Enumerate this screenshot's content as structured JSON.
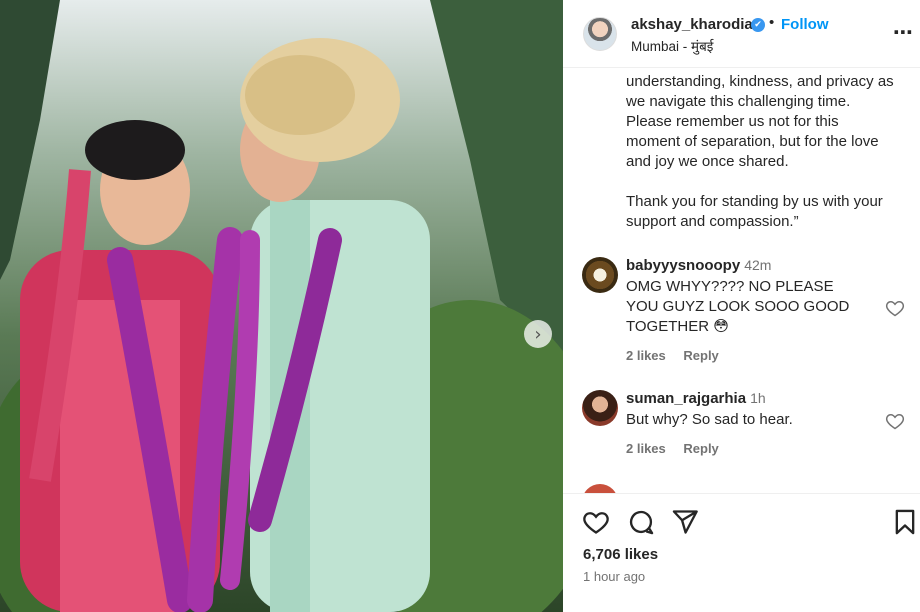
{
  "post": {
    "username": "akshay_kharodia",
    "verified_mark": "✔",
    "separator": "•",
    "follow_label": "Follow",
    "location": "Mumbai - मुंबई",
    "more_icon": "⋯",
    "next_icon": "›"
  },
  "caption": {
    "lines_1": [
      "understanding, kindness, and privacy as",
      "we navigate this challenging time.",
      "Please remember us not for this",
      "moment of separation, but for the love",
      "and joy we once shared."
    ],
    "lines_2": [
      "Thank you for standing by us with your",
      "support and compassion.”"
    ]
  },
  "comments": [
    {
      "username": "babyyysnooopy",
      "time": "42m",
      "text": "OMG WHYY???? NO PLEASE YOU GUYZ LOOK SOOO GOOD TOGETHER 😳",
      "likes": "2 likes",
      "reply": "Reply"
    },
    {
      "username": "suman_rajgarhia",
      "time": "1h",
      "text": "But why? So sad to hear.",
      "likes": "2 likes",
      "reply": "Reply"
    }
  ],
  "footer": {
    "likes": "6,706 likes",
    "posted": "1 hour ago"
  },
  "colors": {
    "accent": "#0095f6",
    "verified": "#3897f0",
    "muted": "#737373",
    "text": "#262626"
  },
  "icons": [
    "heart-icon",
    "comment-icon",
    "share-icon",
    "bookmark-icon",
    "verified-icon",
    "more-icon",
    "chevron-right-icon"
  ]
}
